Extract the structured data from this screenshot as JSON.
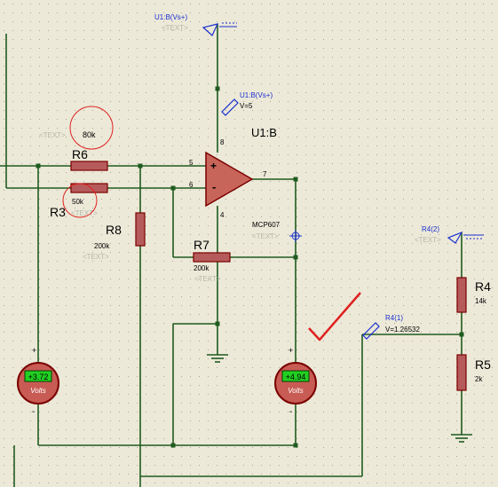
{
  "colors": {
    "background": "#ece9d8",
    "grid_dot": "#a8a69a",
    "wire": "#1f5b1f",
    "component_body": "#b65b5b",
    "component_outline": "#7a0000",
    "opamp_fill": "#c8655a",
    "label_dark": "#000000",
    "label_grey": "#b7b5ab",
    "probe_blue": "#1a2fd0",
    "annotation_red": "#e02020",
    "meter_display": "#22d022",
    "meter_fill": "#c85c54"
  },
  "opamp": {
    "ref": "U1:B",
    "part": "MCP607",
    "text_placeholder": "<TEXT>",
    "pin_noninv": "5",
    "pin_inv": "6",
    "pin_out": "7",
    "pin_vplus": "8",
    "pin_gnd": "4",
    "plus_sign": "+",
    "minus_sign": "-"
  },
  "terminals": {
    "top_supply": {
      "label": "U1:B(Vs+)",
      "text": "<TEXT>"
    },
    "rail_probe": {
      "label": "U1:B(Vs+)",
      "value": "V=5"
    },
    "r4_terminal": {
      "label": "R4(2)",
      "text": "<TEXT>"
    },
    "r4_probe": {
      "label": "R4(1)",
      "value": "V=1.26532"
    }
  },
  "resistors": {
    "r6": {
      "ref": "R6",
      "value": "80k"
    },
    "r3": {
      "ref": "R3",
      "value": "50k",
      "text": "<TEXT>"
    },
    "r8": {
      "ref": "R8",
      "value": "200k",
      "text": "<TEXT>"
    },
    "r7": {
      "ref": "R7",
      "value": "200k",
      "text": "<TEXT>"
    },
    "r4": {
      "ref": "R4",
      "value": "14k"
    },
    "r5": {
      "ref": "R5",
      "value": "2k"
    }
  },
  "annotations": {
    "r6_circle_note": "80k",
    "r6_circle_text": "<TEXT>"
  },
  "meters": {
    "left": {
      "reading": "+3.72",
      "unit": "Volts",
      "plus": "+",
      "minus": "-"
    },
    "right": {
      "reading": "+4.94",
      "unit": "Volts",
      "plus": "+",
      "minus": "-"
    }
  }
}
